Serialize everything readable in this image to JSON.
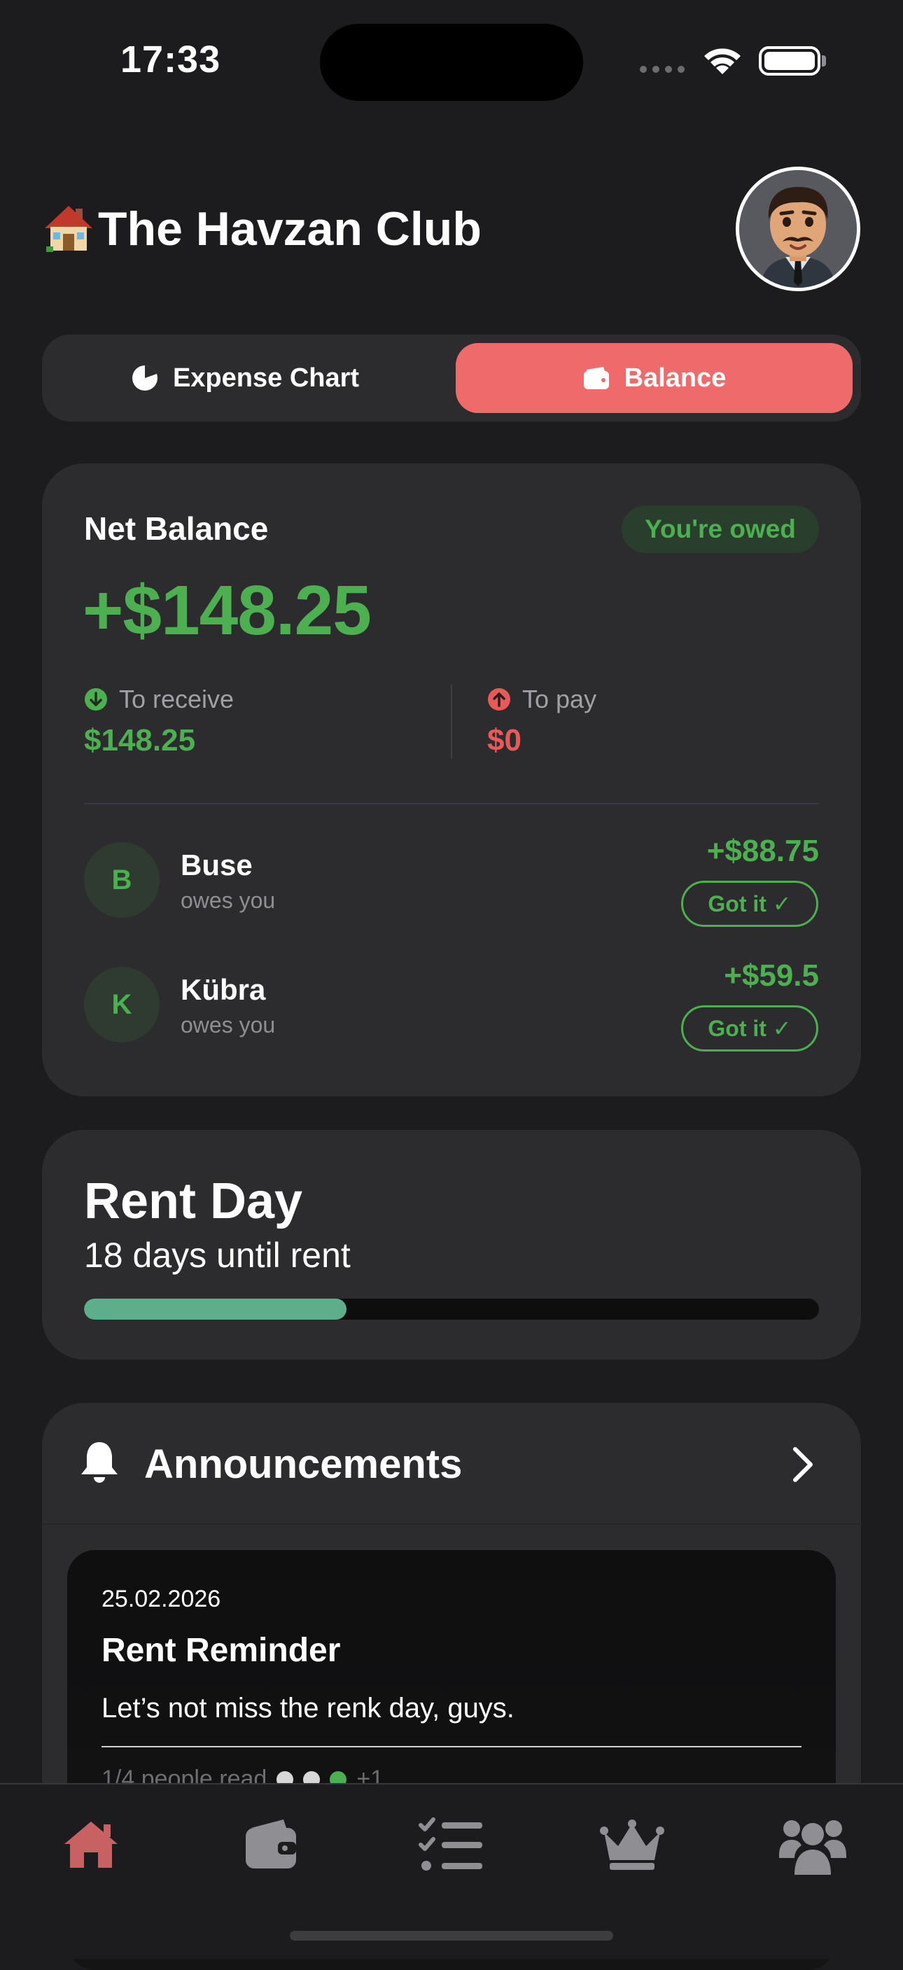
{
  "status_bar": {
    "time": "17:33"
  },
  "header": {
    "house_emoji": "🏠",
    "title": "The Havzan Club"
  },
  "segments": [
    {
      "label": "Expense Chart",
      "selected": false
    },
    {
      "label": "Balance",
      "selected": true
    }
  ],
  "balance": {
    "net_label": "Net Balance",
    "badge": "You're owed",
    "net_amount": "+$148.25",
    "receive_label": "To receive",
    "receive_value": "$148.25",
    "pay_label": "To pay",
    "pay_value": "$0",
    "people": [
      {
        "initial": "B",
        "name": "Buse",
        "status": "owes you",
        "amount": "+$88.75",
        "action": "Got it ✓"
      },
      {
        "initial": "K",
        "name": "Kübra",
        "status": "owes you",
        "amount": "+$59.5",
        "action": "Got it ✓"
      }
    ]
  },
  "rent": {
    "title": "Rent Day",
    "subtitle": "18 days until rent",
    "progress": 0.357
  },
  "announcements": {
    "title": "Announcements",
    "items": [
      {
        "date": "25.02.2026",
        "title": "Rent Reminder",
        "body": "Let’s not miss the renk day, guys.",
        "read_status": "1/4 people read",
        "extra_readers": "+1"
      }
    ]
  },
  "tabbar": {
    "items": [
      {
        "icon": "home-icon",
        "selected": true
      },
      {
        "icon": "wallet-icon",
        "selected": false
      },
      {
        "icon": "checklist-icon",
        "selected": false
      },
      {
        "icon": "crown-icon",
        "selected": false
      },
      {
        "icon": "users-icon",
        "selected": false
      }
    ]
  },
  "colors": {
    "accent": "#ef6b6b",
    "positive": "#4caf50",
    "negative": "#e85a5a",
    "progress": "#5fae8b",
    "tab_selected": "#c86161",
    "tab_unselected": "#8e8e93"
  }
}
